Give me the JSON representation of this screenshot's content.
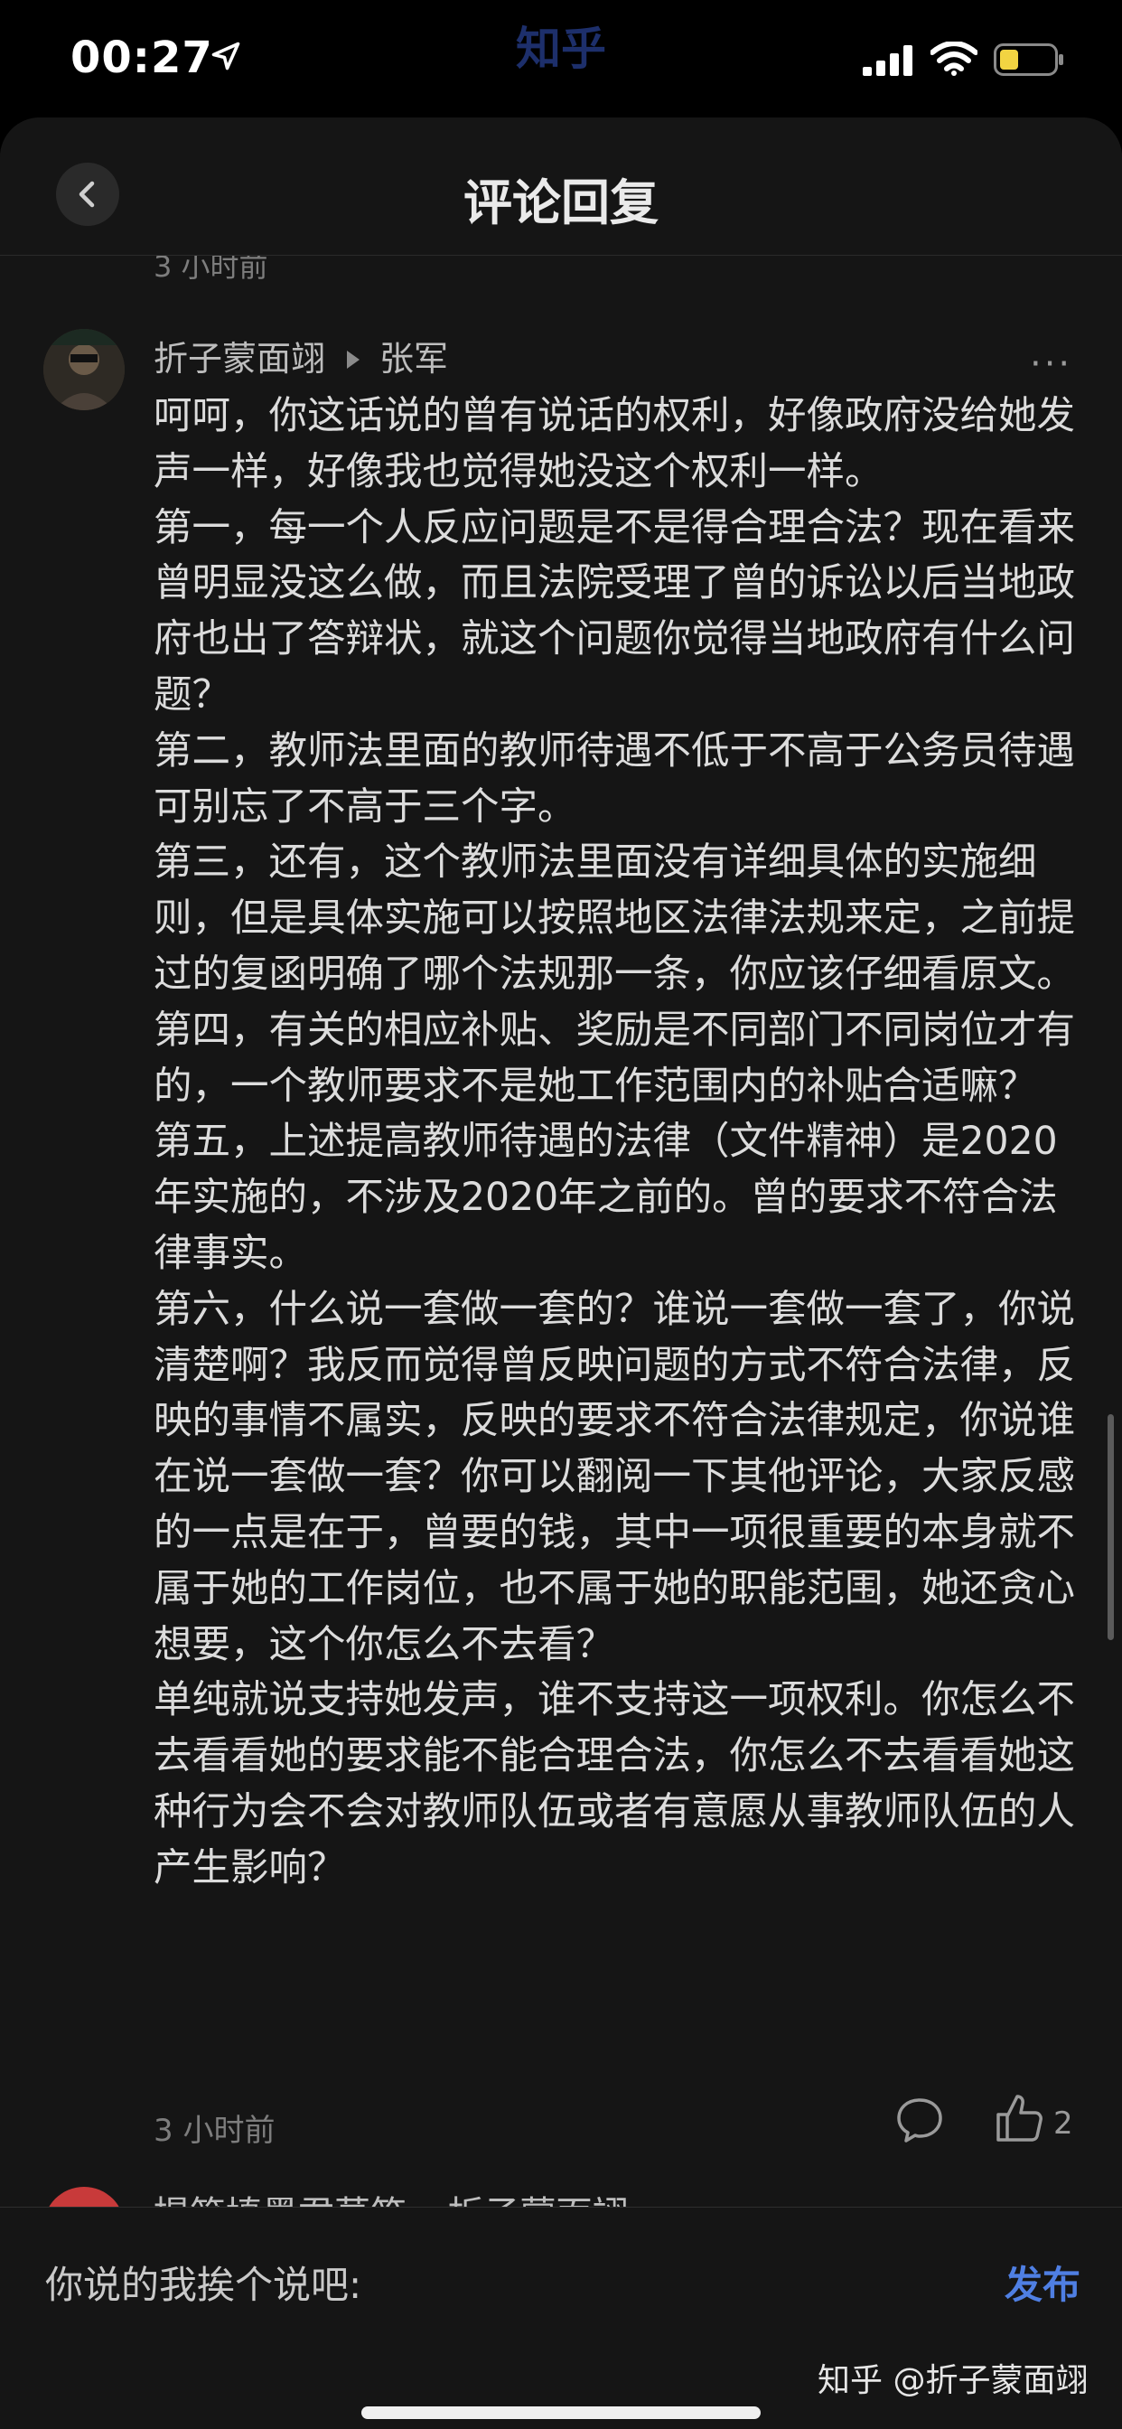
{
  "status_bar": {
    "time": "00:27",
    "app_watermark": "知乎",
    "icons": [
      "location-arrow-icon",
      "signal-icon",
      "wifi-icon",
      "battery-icon"
    ]
  },
  "header": {
    "title": "评论回复",
    "back_icon": "chevron-left-icon"
  },
  "previous_comment": {
    "time": "3 小时前"
  },
  "comment": {
    "author": "折子蒙面翊",
    "reply_to": "张军",
    "more_label": "···",
    "paragraphs": [
      "呵呵，你这话说的曾有说话的权利，好像政府没给她发声一样，好像我也觉得她没这个权利一样。",
      "第一，每一个人反应问题是不是得合理合法？现在看来曾明显没这么做，而且法院受理了曾的诉讼以后当地政府也出了答辩状，就这个问题你觉得当地政府有什么问题？",
      "第二，教师法里面的教师待遇不低于不高于公务员待遇可别忘了不高于三个字。",
      "第三，还有，这个教师法里面没有详细具体的实施细则，但是具体实施可以按照地区法律法规来定，之前提过的复函明确了哪个法规那一条，你应该仔细看原文。",
      "第四，有关的相应补贴、奖励是不同部门不同岗位才有的，一个教师要求不是她工作范围内的补贴合适嘛？",
      "第五，上述提高教师待遇的法律（文件精神）是2020年实施的，不涉及2020年之前的。曾的要求不符合法律事实。",
      "第六，什么说一套做一套的？谁说一套做一套了，你说清楚啊？我反而觉得曾反映问题的方式不符合法律，反映的事情不属实，反映的要求不符合法律规定，你说谁在说一套做一套？你可以翻阅一下其他评论，大家反感的一点是在于，曾要的钱，其中一项很重要的本身就不属于她的工作岗位，也不属于她的职能范围，她还贪心想要，这个你怎么不去看？",
      "单纯就说支持她发声，谁不支持这一项权利。你怎么不去看看她的要求能不能合理合法，你怎么不去看看她这种行为会不会对教师队伍或者有意愿从事教师队伍的人产生影响？"
    ],
    "time": "3 小时前",
    "like_count": "2"
  },
  "next_comment_peek": {
    "text": "提笔填墨君莫笑 ▸ 折子蒙面翊"
  },
  "input_bar": {
    "input_text": "你说的我挨个说吧:",
    "publish_label": "发布",
    "attribution": "知乎 @折子蒙面翊"
  },
  "colors": {
    "background": "#000000",
    "sheet": "#151515",
    "accent": "#4f7fe3",
    "text_main": "#dcdcdc",
    "text_muted": "#7d7d7d"
  }
}
